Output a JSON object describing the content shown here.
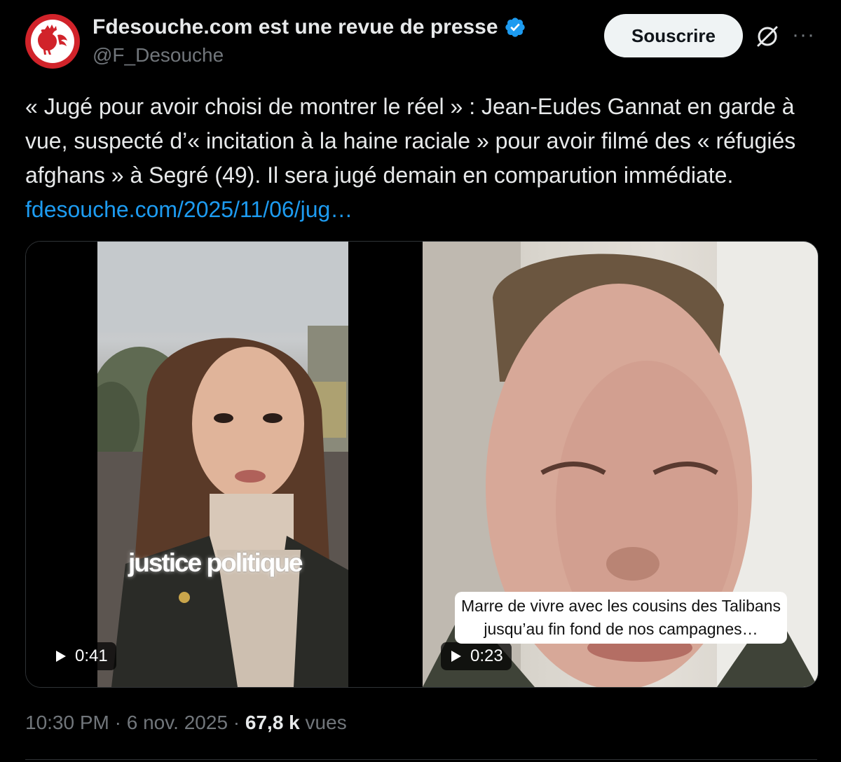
{
  "author": {
    "display_name": "Fdesouche.com est une revue de presse",
    "handle": "@F_Desouche",
    "verified": true,
    "avatar_icon": "rooster-logo-icon"
  },
  "actions": {
    "subscribe_label": "Souscrire",
    "grok_icon": "grok-icon",
    "more_icon": "more-options-icon"
  },
  "tweet": {
    "text": "« Jugé pour avoir choisi de montrer le réel » : Jean-Eudes Gannat en garde à vue, suspecté d’« incitation à la haine raciale » pour avoir filmé des « réfugiés afghans » à Segré (49). Il sera jugé demain en comparution immédiate. ",
    "link_text": "fdesouche.com/2025/11/06/jug…"
  },
  "media": [
    {
      "kind": "video",
      "duration": "0:41",
      "overlay_text": "justice politique"
    },
    {
      "kind": "video",
      "duration": "0:23",
      "caption": "Marre de vivre avec les cousins des Talibans jusqu’au fin fond de nos campagnes…"
    }
  ],
  "footer": {
    "time": "10:30 PM",
    "separator": " · ",
    "date": "6 nov. 2025",
    "views_count": "67,8 k",
    "views_label": "vues"
  },
  "colors": {
    "background": "#000000",
    "text": "#e7e9ea",
    "muted": "#71767b",
    "link": "#1d9bf0",
    "verified": "#1d9bf0",
    "avatar_red": "#d1232a"
  }
}
